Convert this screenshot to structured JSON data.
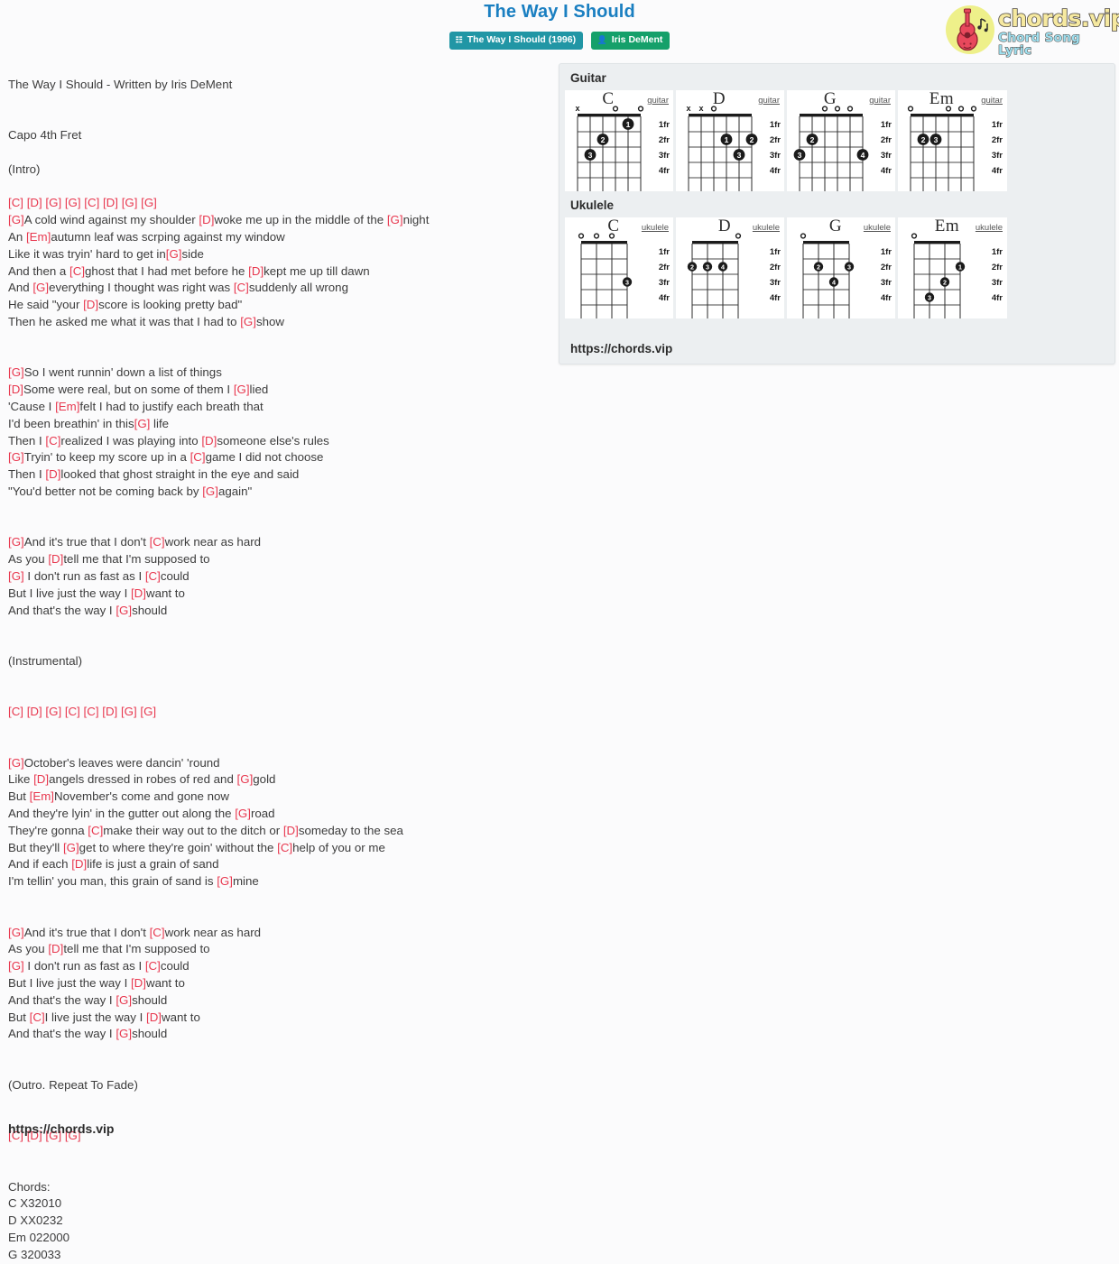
{
  "header": {
    "title": "The Way I Should",
    "album_badge": {
      "label": "The Way I Should (1996)",
      "icon": "album-icon",
      "color": "#2196a5"
    },
    "artist_badge": {
      "label": "Iris DeMent",
      "icon": "user-icon",
      "color": "#15a06a"
    }
  },
  "logo": {
    "main": "chords.vip",
    "sub": "Chord Song Lyric",
    "icon": "guitar-icon",
    "main_color": "#f6e9a0",
    "sub_color": "#9fe0f0",
    "circle_color": "#eef08a",
    "guitar_color": "#e8485c"
  },
  "song": {
    "credit": "The Way I Should - Written by Iris DeMent",
    "capo": "Capo 4th Fret",
    "chord_color": "#e8384f",
    "lyric_color": "#3c3c3c",
    "lines": [
      "",
      "The Way I Should - Written by Iris DeMent",
      "",
      "",
      "Capo 4th Fret",
      "",
      "(Intro)",
      "",
      "[C] [D] [G] [G] [C] [D] [G] [G]",
      "[G]A cold wind against my shoulder [D]woke me up in the middle of the [G]night",
      "An [Em]autumn leaf was scrping against my window",
      "Like it was tryin' hard to get in[G]side",
      "And then a [C]ghost that I had met before he [D]kept me up till dawn",
      "And [G]everything I thought was right was [C]suddenly all wrong",
      "He said \"your [D]score is looking pretty bad\"",
      "Then he asked me what it was that I had to [G]show",
      "",
      "",
      "[G]So I went runnin' down a list of things",
      "[D]Some were real, but on some of them I [G]lied",
      "'Cause I [Em]felt I had to justify each breath that",
      "I'd been breathin' in this[G] life",
      "Then I [C]realized I was playing into [D]someone else's rules",
      "[G]Tryin' to keep my score up in a [C]game I did not choose",
      "Then I [D]looked that ghost straight in the eye and said",
      "\"You'd better not be coming back by [G]again\"",
      "",
      "",
      "[G]And it's true that I don't [C]work near as hard",
      "As you [D]tell me that I'm supposed to",
      "[G] I don't run as fast as I [C]could",
      "But I live just the way I [D]want to",
      "And that's the way I [G]should",
      "",
      "",
      "(Instrumental)",
      "",
      "",
      "[C] [D] [G] [C] [C] [D] [G] [G]",
      "",
      "",
      "[G]October's leaves were dancin' 'round",
      "Like [D]angels dressed in robes of red and [G]gold",
      "But [Em]November's come and gone now",
      "And they're lyin' in the gutter out along the [G]road",
      "They're gonna [C]make their way out to the ditch or [D]someday to the sea",
      "But they'll [G]get to where they're goin' without the [C]help of you or me",
      "And if each [D]life is just a grain of sand",
      "I'm tellin' you man, this grain of sand is [G]mine",
      "",
      "",
      "[G]And it's true that I don't [C]work near as hard",
      "As you [D]tell me that I'm supposed to",
      "[G] I don't run as fast as I [C]could",
      "But I live just the way I [D]want to",
      "And that's the way I [G]should",
      "But [C]I live just the way I [D]want to",
      "And that's the way I [G]should",
      "",
      "",
      "(Outro. Repeat To Fade)",
      "",
      "",
      "[C] [D] [G] [G]",
      "",
      "",
      "Chords:",
      "C X32010",
      "D XX0232",
      "Em 022000",
      "G 320033"
    ]
  },
  "footer": {
    "url": "https://chords.vip"
  },
  "panel": {
    "url": "https://chords.vip",
    "sections": [
      {
        "heading": "Guitar",
        "instrument_label": "guitar",
        "strings": 6,
        "fret_labels": [
          "1fr",
          "2fr",
          "3fr",
          "4fr"
        ],
        "chords": [
          {
            "name": "C",
            "tab": "X32010",
            "markers": [
              "x",
              "",
              "",
              "o",
              "",
              "o"
            ],
            "dots": [
              {
                "string": 5,
                "fret": 1,
                "finger": "1"
              },
              {
                "string": 3,
                "fret": 2,
                "finger": "2"
              },
              {
                "string": 2,
                "fret": 3,
                "finger": "3"
              }
            ]
          },
          {
            "name": "D",
            "tab": "XX0232",
            "markers": [
              "x",
              "x",
              "o",
              "",
              "",
              ""
            ],
            "dots": [
              {
                "string": 4,
                "fret": 2,
                "finger": "1"
              },
              {
                "string": 6,
                "fret": 2,
                "finger": "2"
              },
              {
                "string": 5,
                "fret": 3,
                "finger": "3"
              }
            ]
          },
          {
            "name": "G",
            "tab": "320033",
            "markers": [
              "",
              "",
              "o",
              "o",
              "o",
              ""
            ],
            "dots": [
              {
                "string": 2,
                "fret": 2,
                "finger": "2"
              },
              {
                "string": 1,
                "fret": 3,
                "finger": "3"
              },
              {
                "string": 6,
                "fret": 3,
                "finger": "4"
              }
            ]
          },
          {
            "name": "Em",
            "tab": "022000",
            "markers": [
              "o",
              "",
              "",
              "o",
              "o",
              "o"
            ],
            "dots": [
              {
                "string": 2,
                "fret": 2,
                "finger": "2"
              },
              {
                "string": 3,
                "fret": 2,
                "finger": "3"
              }
            ]
          }
        ]
      },
      {
        "heading": "Ukulele",
        "instrument_label": "ukulele",
        "strings": 4,
        "fret_labels": [
          "1fr",
          "2fr",
          "3fr",
          "4fr"
        ],
        "chords": [
          {
            "name": "C",
            "markers": [
              "o",
              "o",
              "o",
              ""
            ],
            "dots": [
              {
                "string": 4,
                "fret": 3,
                "finger": "3"
              }
            ]
          },
          {
            "name": "D",
            "markers": [
              "",
              "",
              "",
              "o"
            ],
            "dots": [
              {
                "string": 1,
                "fret": 2,
                "finger": "2"
              },
              {
                "string": 2,
                "fret": 2,
                "finger": "3"
              },
              {
                "string": 3,
                "fret": 2,
                "finger": "4"
              }
            ]
          },
          {
            "name": "G",
            "markers": [
              "o",
              "",
              "",
              ""
            ],
            "dots": [
              {
                "string": 2,
                "fret": 2,
                "finger": "2"
              },
              {
                "string": 4,
                "fret": 2,
                "finger": "3"
              },
              {
                "string": 3,
                "fret": 3,
                "finger": "4"
              }
            ]
          },
          {
            "name": "Em",
            "markers": [
              "o",
              "",
              "",
              ""
            ],
            "dots": [
              {
                "string": 4,
                "fret": 2,
                "finger": "1"
              },
              {
                "string": 3,
                "fret": 3,
                "finger": "2"
              },
              {
                "string": 2,
                "fret": 4,
                "finger": "3"
              }
            ]
          }
        ]
      }
    ]
  }
}
